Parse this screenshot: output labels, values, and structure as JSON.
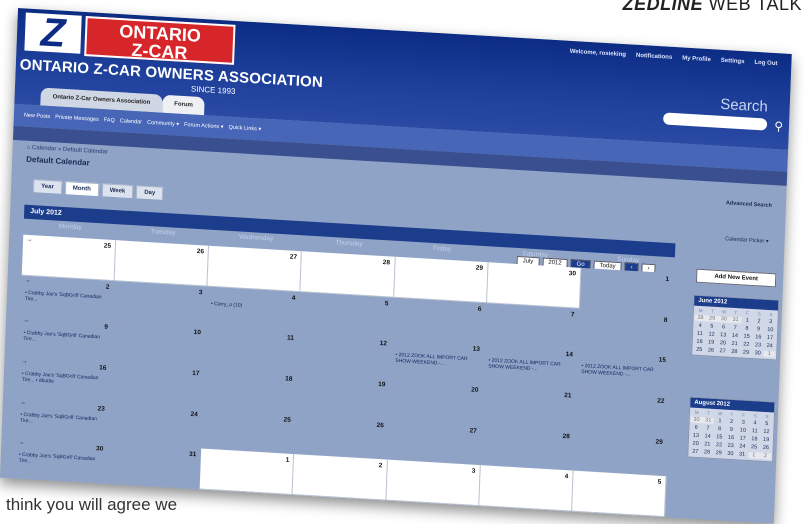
{
  "magazine": {
    "brand": "ZEDLINE",
    "section": "WEB TALK"
  },
  "caption": "think you will agree we",
  "site": {
    "logo_letter": "Z",
    "logo_red_line1": "ONTARIO",
    "logo_red_line2": "Z-CAR",
    "association": "ONTARIO Z-CAR OWNERS ASSOCIATION",
    "since": "SINCE 1993",
    "user_nav": [
      "Welcome, rosieking",
      "Notifications",
      "My Profile",
      "Settings",
      "Log Out"
    ],
    "search_label": "Search",
    "search_placeholder": ""
  },
  "tabs": [
    "Ontario Z-Car Owners Association",
    "Forum"
  ],
  "subnav": [
    "New Posts",
    "Private Messages",
    "FAQ",
    "Calendar",
    "Community ▾",
    "Forum Actions ▾",
    "Quick Links ▾"
  ],
  "breadcrumb": {
    "home": "Calendar",
    "current": "Default Calendar"
  },
  "page_title": "Default Calendar",
  "advanced_search": "Advanced Search",
  "calendar_tabs": [
    "Year",
    "Month",
    "Week",
    "Day"
  ],
  "calendar_picker": "Calendar Picker ▾",
  "month_label": "July 2012",
  "controls": {
    "month": "July",
    "year": "2012",
    "go": "Go",
    "today": "Today",
    "prev": "‹",
    "next": "›"
  },
  "add_event": "Add New Event",
  "weekdays": [
    "Monday",
    "Tuesday",
    "Wednesday",
    "Thursday",
    "Friday",
    "Saturday",
    "Sunday"
  ],
  "weeks": [
    [
      {
        "n": "25",
        "o": true,
        "a": "→"
      },
      {
        "n": "26",
        "o": true
      },
      {
        "n": "27",
        "o": true
      },
      {
        "n": "28",
        "o": true
      },
      {
        "n": "29",
        "o": true
      },
      {
        "n": "30",
        "o": true
      },
      {
        "n": "1"
      }
    ],
    [
      {
        "n": "2",
        "a": "→",
        "e": "• Crabby Joe's 'SqBGrill' Canadian Tire..."
      },
      {
        "n": "3"
      },
      {
        "n": "4",
        "e": "• Carry_o (10)"
      },
      {
        "n": "5"
      },
      {
        "n": "6"
      },
      {
        "n": "7"
      },
      {
        "n": "8"
      }
    ],
    [
      {
        "n": "9",
        "a": "→",
        "e": "• Crabby Joe's 'SqBGrill' Canadian Tire..."
      },
      {
        "n": "10"
      },
      {
        "n": "11"
      },
      {
        "n": "12"
      },
      {
        "n": "13",
        "e": "• 2012 ZOOK ALL IMPORT CAR SHOW WEEKEND -..."
      },
      {
        "n": "14",
        "e": "• 2012 ZOOK ALL IMPORT CAR SHOW WEEKEND -..."
      },
      {
        "n": "15",
        "e": "• 2012 ZOOK ALL IMPORT CAR SHOW WEEKEND -..."
      }
    ],
    [
      {
        "n": "16",
        "a": "→",
        "e": "• Crabby Joe's 'SqBGrill' Canadian Tire... • dbuttle"
      },
      {
        "n": "17"
      },
      {
        "n": "18"
      },
      {
        "n": "19"
      },
      {
        "n": "20"
      },
      {
        "n": "21"
      },
      {
        "n": "22"
      }
    ],
    [
      {
        "n": "23",
        "a": "→",
        "e": "• Crabby Joe's 'SqBGrill' Canadian Tire..."
      },
      {
        "n": "24"
      },
      {
        "n": "25"
      },
      {
        "n": "26"
      },
      {
        "n": "27"
      },
      {
        "n": "28"
      },
      {
        "n": "29"
      }
    ],
    [
      {
        "n": "30",
        "a": "→",
        "e": "• Crabby Joe's 'SqBGrill' Canadian Tire..."
      },
      {
        "n": "31"
      },
      {
        "n": "1",
        "o": true
      },
      {
        "n": "2",
        "o": true
      },
      {
        "n": "3",
        "o": true
      },
      {
        "n": "4",
        "o": true
      },
      {
        "n": "5",
        "o": true
      }
    ]
  ],
  "mini_june": {
    "title": "June 2012",
    "head": [
      "M",
      "T",
      "W",
      "T",
      "F",
      "S",
      "S"
    ],
    "days": [
      [
        "28",
        "o"
      ],
      [
        "29",
        "o"
      ],
      [
        "30",
        "o"
      ],
      [
        "31",
        "o"
      ],
      [
        "1"
      ],
      [
        "2"
      ],
      [
        "3"
      ],
      [
        "4"
      ],
      [
        "5"
      ],
      [
        "6"
      ],
      [
        "7"
      ],
      [
        "8"
      ],
      [
        "9"
      ],
      [
        "10"
      ],
      [
        "11"
      ],
      [
        "12"
      ],
      [
        "13"
      ],
      [
        "14"
      ],
      [
        "15"
      ],
      [
        "16"
      ],
      [
        "17"
      ],
      [
        "18"
      ],
      [
        "19"
      ],
      [
        "20"
      ],
      [
        "21"
      ],
      [
        "22"
      ],
      [
        "23"
      ],
      [
        "24"
      ],
      [
        "25"
      ],
      [
        "26"
      ],
      [
        "27"
      ],
      [
        "28"
      ],
      [
        "29"
      ],
      [
        "30"
      ],
      [
        "1",
        "o"
      ]
    ]
  },
  "mini_august": {
    "title": "August 2012",
    "head": [
      "M",
      "T",
      "W",
      "T",
      "F",
      "S",
      "S"
    ],
    "days": [
      [
        "30",
        "o"
      ],
      [
        "31",
        "o"
      ],
      [
        "1"
      ],
      [
        "2"
      ],
      [
        "3"
      ],
      [
        "4"
      ],
      [
        "5"
      ],
      [
        "6"
      ],
      [
        "7"
      ],
      [
        "8"
      ],
      [
        "9"
      ],
      [
        "10"
      ],
      [
        "11"
      ],
      [
        "12"
      ],
      [
        "13"
      ],
      [
        "14"
      ],
      [
        "15"
      ],
      [
        "16"
      ],
      [
        "17"
      ],
      [
        "18"
      ],
      [
        "19"
      ],
      [
        "20"
      ],
      [
        "21"
      ],
      [
        "22"
      ],
      [
        "23"
      ],
      [
        "24"
      ],
      [
        "25"
      ],
      [
        "26"
      ],
      [
        "27"
      ],
      [
        "28"
      ],
      [
        "29"
      ],
      [
        "30"
      ],
      [
        "31"
      ],
      [
        "1",
        "o"
      ],
      [
        "2",
        "o"
      ]
    ]
  }
}
